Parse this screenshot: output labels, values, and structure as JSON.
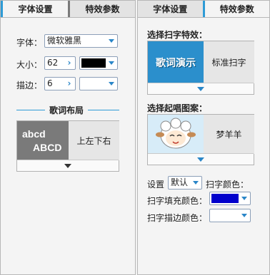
{
  "tabs": {
    "left": [
      "字体设置",
      "特效参数"
    ],
    "right": [
      "字体设置",
      "特效参数"
    ]
  },
  "font_settings": {
    "font_label": "字体：",
    "font_value": "微软雅黑",
    "size_label": "大小：",
    "size_value": "62",
    "color_value": "#000000",
    "stroke_label": "描边：",
    "stroke_value": "6",
    "stroke_color_value": "#ffffff"
  },
  "lyric_layout": {
    "title": "歌词布局",
    "sample_line1": "abcd",
    "sample_line2": "ABCD",
    "option": "上左下右"
  },
  "effects": {
    "scan_title": "选择扫字特效：",
    "scan_preview_text": "歌词演示",
    "scan_option": "标准扫字",
    "pattern_title": "选择起唱图案：",
    "pattern_option": "梦羊羊"
  },
  "color_settings": {
    "setting_label": "设置",
    "setting_value": "默认",
    "scan_color_label": "扫字颜色：",
    "fill_label": "扫字填充颜色：",
    "fill_color": "#0000cc",
    "stroke_label": "扫字描边颜色：",
    "stroke_color": "#ffffff"
  },
  "colors": {
    "accent": "#2e9bd6",
    "dropdown_arrow": "#2a86c8"
  }
}
